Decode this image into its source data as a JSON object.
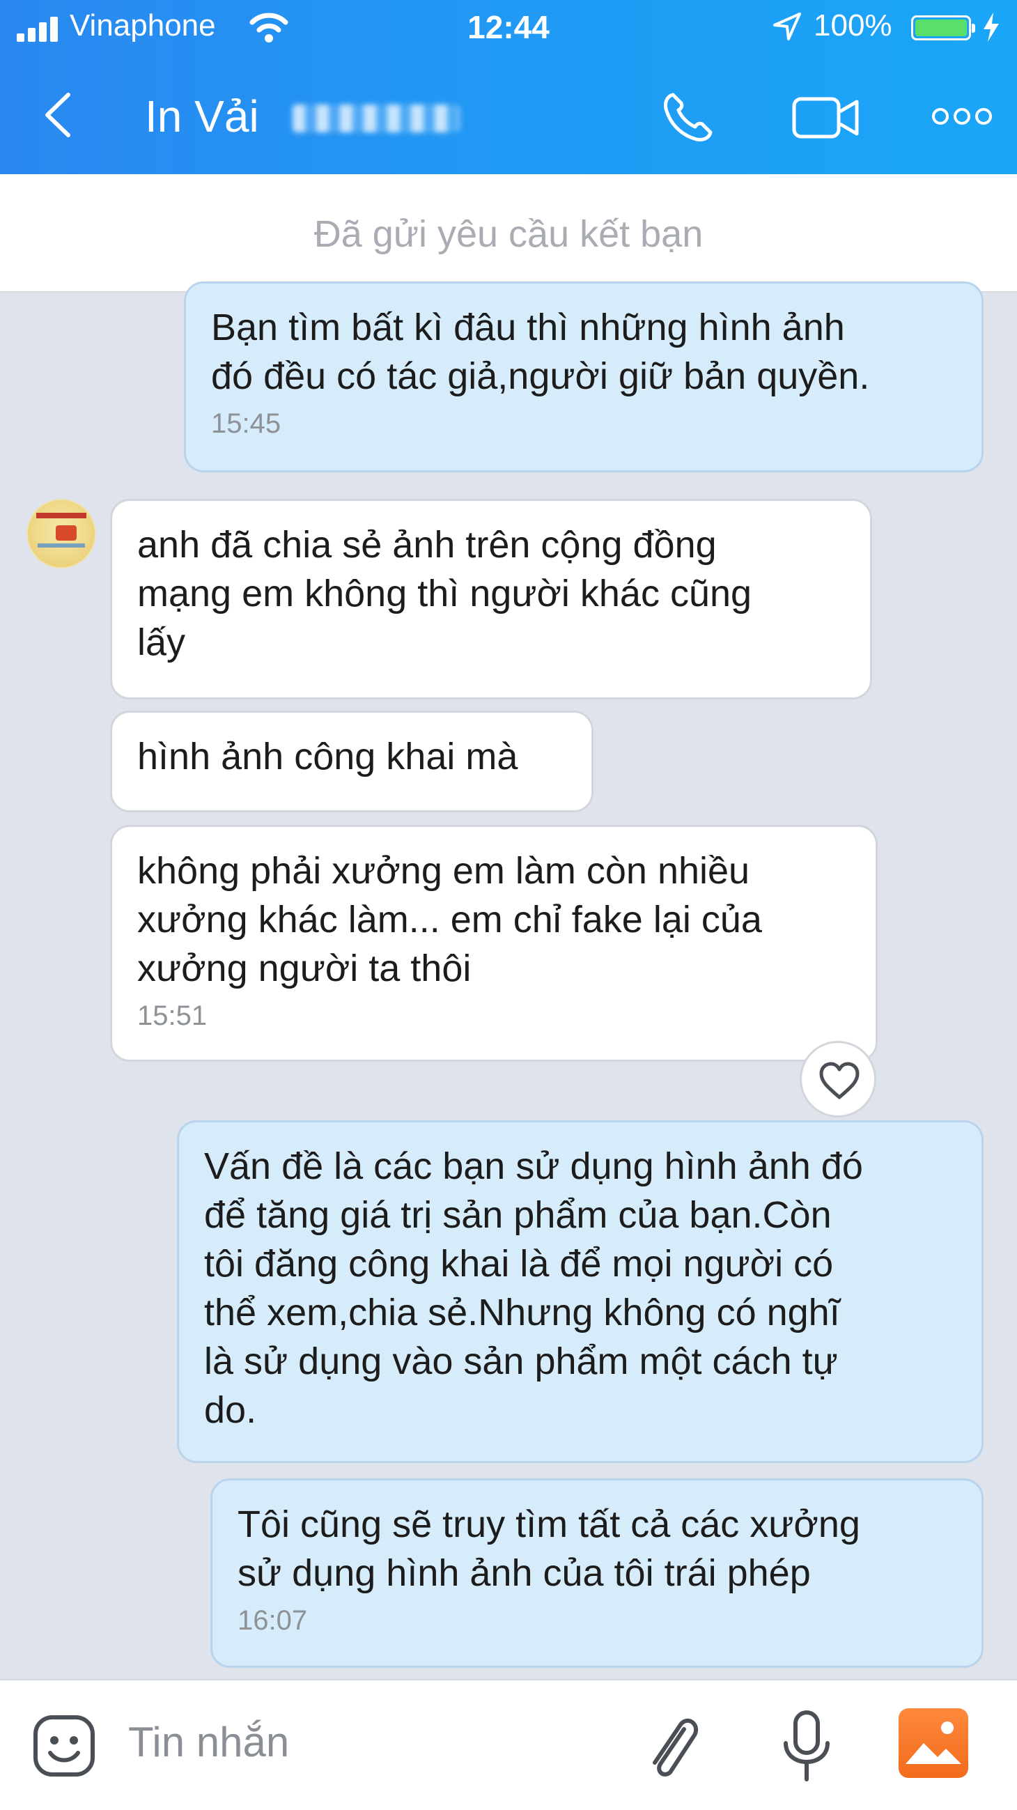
{
  "status_bar": {
    "carrier": "Vinaphone",
    "time": "12:44",
    "battery": "100%",
    "battery_level": 1.0
  },
  "header": {
    "title": "In Vải"
  },
  "friend_request_status": "Đã gửi yêu cầu kết bạn",
  "messages": [
    {
      "side": "me",
      "text": "Bạn tìm bất kì đâu thì những hình ảnh\nđó đều có tác giả,người giữ bản quyền.",
      "time": "15:45"
    },
    {
      "side": "them",
      "text": "anh đã chia sẻ ảnh trên cộng đồng\nmạng em không thì người khác cũng\nlấy",
      "time": ""
    },
    {
      "side": "them",
      "text": "hình ảnh công khai mà",
      "time": ""
    },
    {
      "side": "them",
      "text": "không phải xưởng em làm còn nhiều\nxưởng khác làm... em chỉ fake lại của\nxưởng người ta thôi",
      "time": "15:51"
    },
    {
      "side": "me",
      "text": "Vấn đề là các bạn sử dụng hình ảnh đó\nđể tăng giá trị sản phẩm của bạn.Còn\ntôi đăng công khai là để mọi người có\nthể xem,chia sẻ.Nhưng không có nghĩ\nlà sử dụng vào sản phẩm một cách tự\ndo.",
      "time": ""
    },
    {
      "side": "me",
      "text": "Tôi cũng sẽ truy tìm tất cả các xưởng\nsử dụng hình ảnh của tôi trái phép",
      "time": "16:07"
    }
  ],
  "input": {
    "placeholder": "Tin nhắn"
  },
  "icons": {
    "back": "chevron-left-icon",
    "call": "phone-icon",
    "video": "video-camera-icon",
    "more": "more-dots-icon",
    "reaction": "heart-icon",
    "emoji": "emoji-icon",
    "attach": "paperclip-icon",
    "mic": "microphone-icon",
    "photo": "photo-icon"
  },
  "colors": {
    "header_blue": "#1f9bf5",
    "my_bubble": "#d7ecfb",
    "their_bubble": "#ffffff",
    "chat_bg": "#dfe4ec",
    "battery_green": "#58e06a",
    "photo_orange": "#f26a1b"
  }
}
